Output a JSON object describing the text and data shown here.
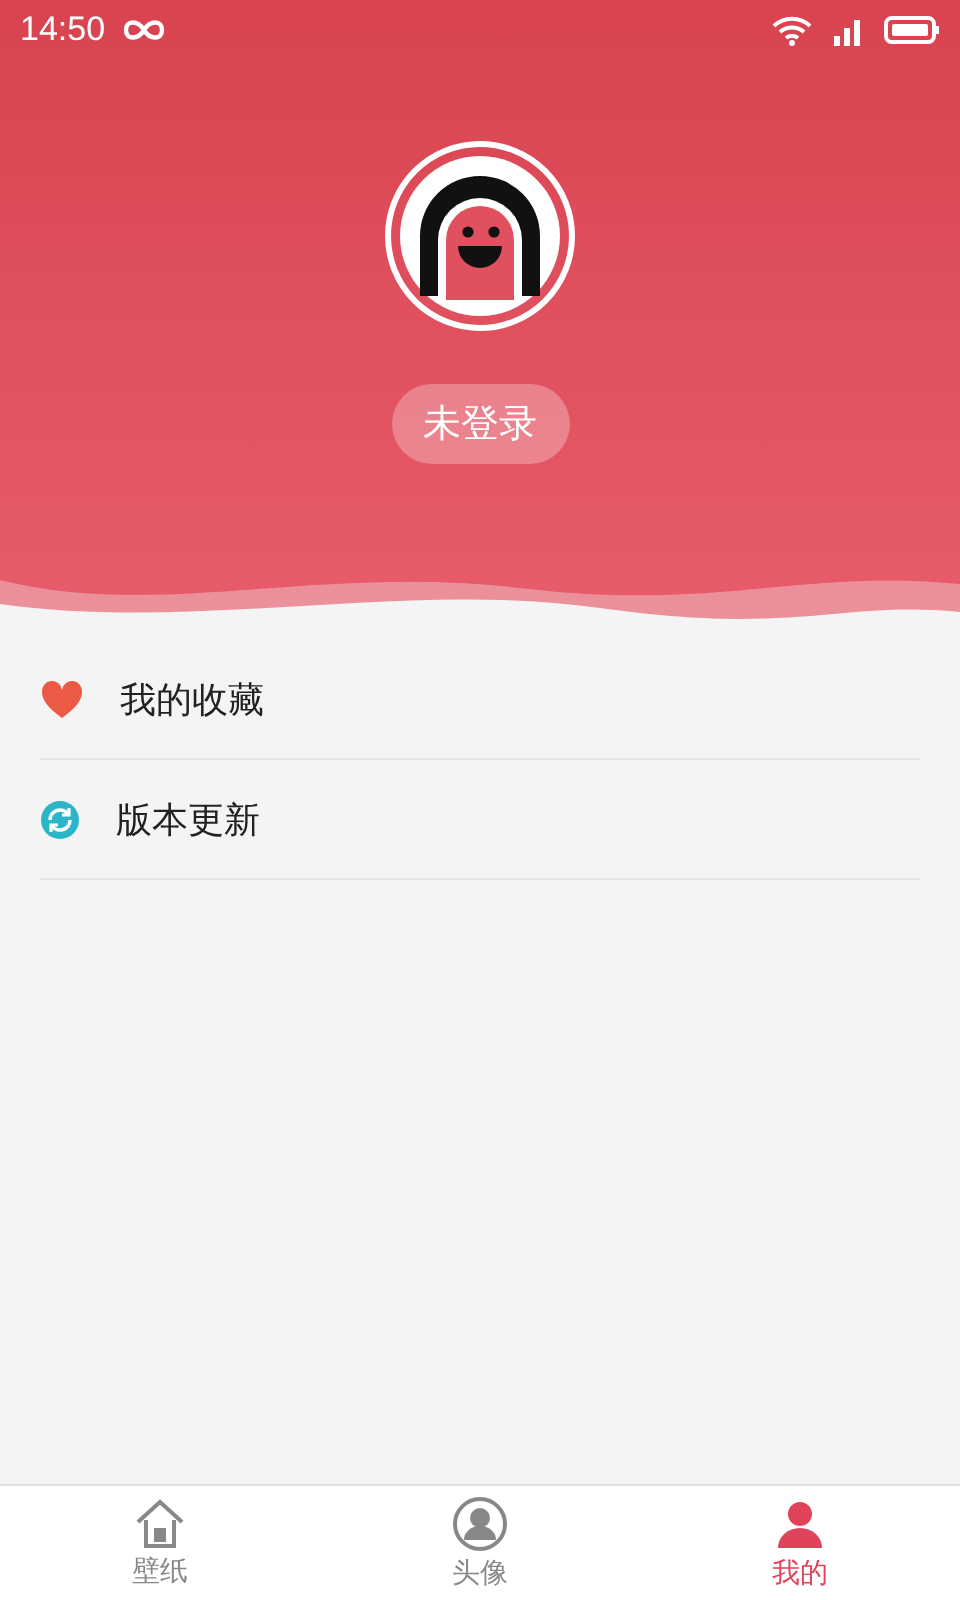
{
  "status_bar": {
    "time": "14:50"
  },
  "profile": {
    "login_label": "未登录"
  },
  "menu": [
    {
      "label": "我的收藏",
      "kind": "heart"
    },
    {
      "label": "版本更新",
      "kind": "refresh"
    }
  ],
  "tabs": [
    {
      "label": "壁纸",
      "kind": "home",
      "selected": false
    },
    {
      "label": "头像",
      "kind": "avatar",
      "selected": false
    },
    {
      "label": "我的",
      "kind": "mine",
      "selected": true
    }
  ]
}
